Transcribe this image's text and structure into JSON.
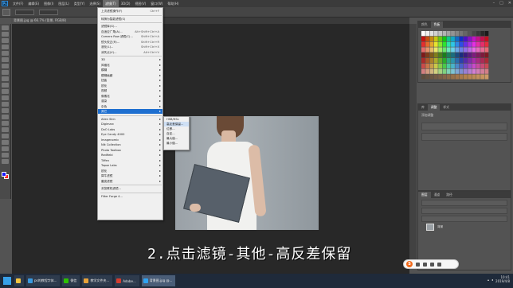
{
  "menubar": {
    "logo": "Ps",
    "items": [
      "文件(F)",
      "编辑(E)",
      "图像(I)",
      "图层(L)",
      "类型(Y)",
      "选择(S)",
      "滤镜(T)",
      "3D(D)",
      "视图(V)",
      "窗口(W)",
      "帮助(H)"
    ],
    "active_index": 6
  },
  "doc_tab": "背景图.jpg @ 66.7% (背景, RGB/8)",
  "filter_menu": {
    "groups": [
      [
        {
          "label": "上次滤镜操作(F)",
          "shortcut": "Ctrl+F"
        }
      ],
      [
        {
          "label": "转换为智能滤镜(S)",
          "shortcut": ""
        }
      ],
      [
        {
          "label": "滤镜库(G)...",
          "shortcut": ""
        },
        {
          "label": "自适应广角(A)...",
          "shortcut": "Alt+Shift+Ctrl+A"
        },
        {
          "label": "Camera Raw 滤镜(C)...",
          "shortcut": "Shift+Ctrl+A"
        },
        {
          "label": "镜头校正(R)...",
          "shortcut": "Shift+Ctrl+R"
        },
        {
          "label": "液化(L)...",
          "shortcut": "Shift+Ctrl+X"
        },
        {
          "label": "消失点(V)...",
          "shortcut": "Alt+Ctrl+V"
        }
      ],
      [
        {
          "label": "3D",
          "shortcut": "",
          "sub": true
        },
        {
          "label": "风格化",
          "shortcut": "",
          "sub": true
        },
        {
          "label": "模糊",
          "shortcut": "",
          "sub": true
        },
        {
          "label": "模糊画廊",
          "shortcut": "",
          "sub": true
        },
        {
          "label": "扭曲",
          "shortcut": "",
          "sub": true
        },
        {
          "label": "锐化",
          "shortcut": "",
          "sub": true
        },
        {
          "label": "视频",
          "shortcut": "",
          "sub": true
        },
        {
          "label": "像素化",
          "shortcut": "",
          "sub": true
        },
        {
          "label": "渲染",
          "shortcut": "",
          "sub": true
        },
        {
          "label": "杂色",
          "shortcut": "",
          "sub": true
        },
        {
          "label": "其它",
          "shortcut": "",
          "sub": true,
          "highlighted": true
        }
      ],
      [
        {
          "label": "Alien Skin",
          "shortcut": "",
          "sub": true
        },
        {
          "label": "Digimarc",
          "shortcut": "",
          "sub": true
        },
        {
          "label": "DxO Labs",
          "shortcut": "",
          "sub": true
        },
        {
          "label": "Eye Candy 4000",
          "shortcut": "",
          "sub": true
        },
        {
          "label": "Imagenomic",
          "shortcut": "",
          "sub": true
        },
        {
          "label": "Nik Collection",
          "shortcut": "",
          "sub": true
        },
        {
          "label": "Photo Toolbox",
          "shortcut": "",
          "sub": true
        },
        {
          "label": "Redfield",
          "shortcut": "",
          "sub": true
        },
        {
          "label": "Tiffen",
          "shortcut": "",
          "sub": true
        },
        {
          "label": "Topaz Labs",
          "shortcut": "",
          "sub": true
        },
        {
          "label": "锐化",
          "shortcut": "",
          "sub": true
        },
        {
          "label": "犀牛滤镜",
          "shortcut": "",
          "sub": true
        },
        {
          "label": "磨皮滤镜",
          "shortcut": "",
          "sub": true
        }
      ],
      [
        {
          "label": "浏览联机滤镜...",
          "shortcut": ""
        }
      ],
      [
        {
          "label": "Filter Forge 4...",
          "shortcut": ""
        }
      ]
    ]
  },
  "other_menu": {
    "items": [
      "HSB/HSL",
      "高反差保留...",
      "位移...",
      "自定...",
      "最大值...",
      "最小值..."
    ],
    "highlighted_index": 1
  },
  "panels": {
    "swatches_tabs": [
      "颜色",
      "色板"
    ],
    "adjust_tabs": [
      "库",
      "调整",
      "样式"
    ],
    "adjust_title": "添加调整",
    "layers_tabs": [
      "图层",
      "通道",
      "路径"
    ],
    "layer_name": "背景"
  },
  "subtitle": "2.点击滤镜-其他-高反差保留",
  "taskbar": {
    "tasks": [
      {
        "label": "",
        "color": "#f5c542"
      },
      {
        "label": "ps的教程字体...",
        "color": "#3a9ae0"
      },
      {
        "label": "微信",
        "color": "#2dc100"
      },
      {
        "label": "教学文件夹...",
        "color": "#e8a33a"
      },
      {
        "label": "Adobe...",
        "color": "#d43d2f"
      },
      {
        "label": "背景图.jpg @...",
        "color": "#2fa3f2",
        "active": true
      }
    ],
    "time": "10:41",
    "date": "2019/4/8"
  },
  "ime": {
    "logo": "S"
  },
  "colors": {
    "menu_highlight": "#1e6fd0",
    "canvas_bg": "#282828",
    "panel_bg": "#535353"
  }
}
